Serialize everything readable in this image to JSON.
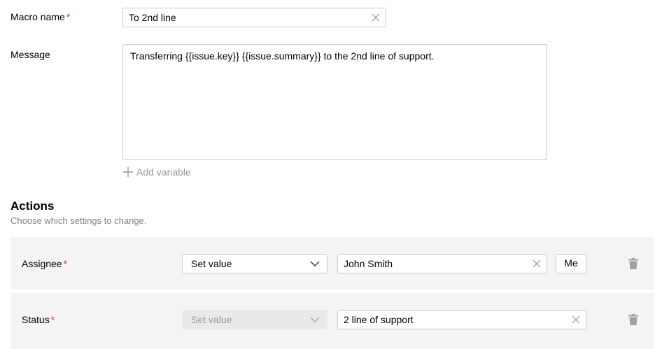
{
  "form": {
    "macro_name": {
      "label": "Macro name",
      "required_mark": "*",
      "value": "To 2nd line"
    },
    "message": {
      "label": "Message",
      "value": "Transferring {{issue.key}} {{issue.summary}} to the 2nd line of support."
    },
    "add_variable_label": "Add variable"
  },
  "actions": {
    "title": "Actions",
    "subtitle": "Choose which settings to change.",
    "rows": [
      {
        "field": "Assignee",
        "required_mark": "*",
        "mode": "Set value",
        "value": "John Smith",
        "me_button": "Me"
      },
      {
        "field": "Status",
        "required_mark": "*",
        "mode": "Set value",
        "value": "2 line of support"
      }
    ]
  },
  "colors": {
    "required": "#e0302a",
    "row_background": "#f4f4f4",
    "muted_text": "#999999"
  },
  "icons": {
    "clear": "close-icon",
    "dropdown": "chevron-down-icon",
    "add": "plus-icon",
    "delete": "trash-icon"
  }
}
